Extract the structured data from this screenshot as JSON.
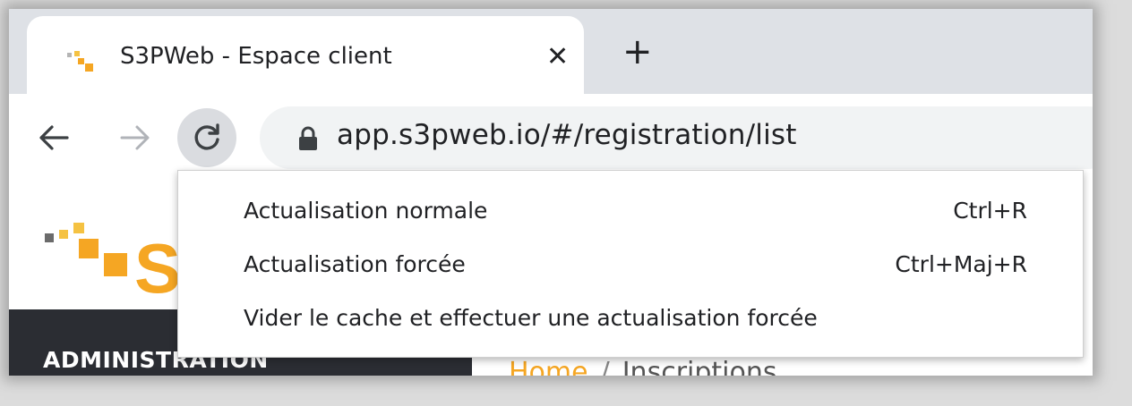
{
  "browser": {
    "tab": {
      "title": "S3PWeb - Espace client",
      "close_glyph": "✕"
    },
    "new_tab_glyph": "+",
    "nav": {
      "back_icon": "arrow-left-icon",
      "forward_icon": "arrow-right-icon",
      "reload_icon": "reload-icon"
    },
    "address": {
      "url": "app.s3pweb.io/#/registration/list",
      "lock_icon": "lock-icon"
    }
  },
  "context_menu": {
    "items": [
      {
        "label": "Actualisation normale",
        "shortcut": "Ctrl+R"
      },
      {
        "label": "Actualisation forcée",
        "shortcut": "Ctrl+Maj+R"
      },
      {
        "label": "Vider le cache et effectuer une actualisation forcée",
        "shortcut": ""
      }
    ]
  },
  "page": {
    "logo_text": "S",
    "sidebar": {
      "title": "ADMINISTRATION"
    },
    "breadcrumb": {
      "home": "Home",
      "separator": "/",
      "current": "Inscriptions"
    }
  },
  "colors": {
    "brand": "#f5a623",
    "sidebar_bg": "#2b2d33",
    "tabstrip_bg": "#dee1e6",
    "omnibox_bg": "#f1f3f4"
  }
}
